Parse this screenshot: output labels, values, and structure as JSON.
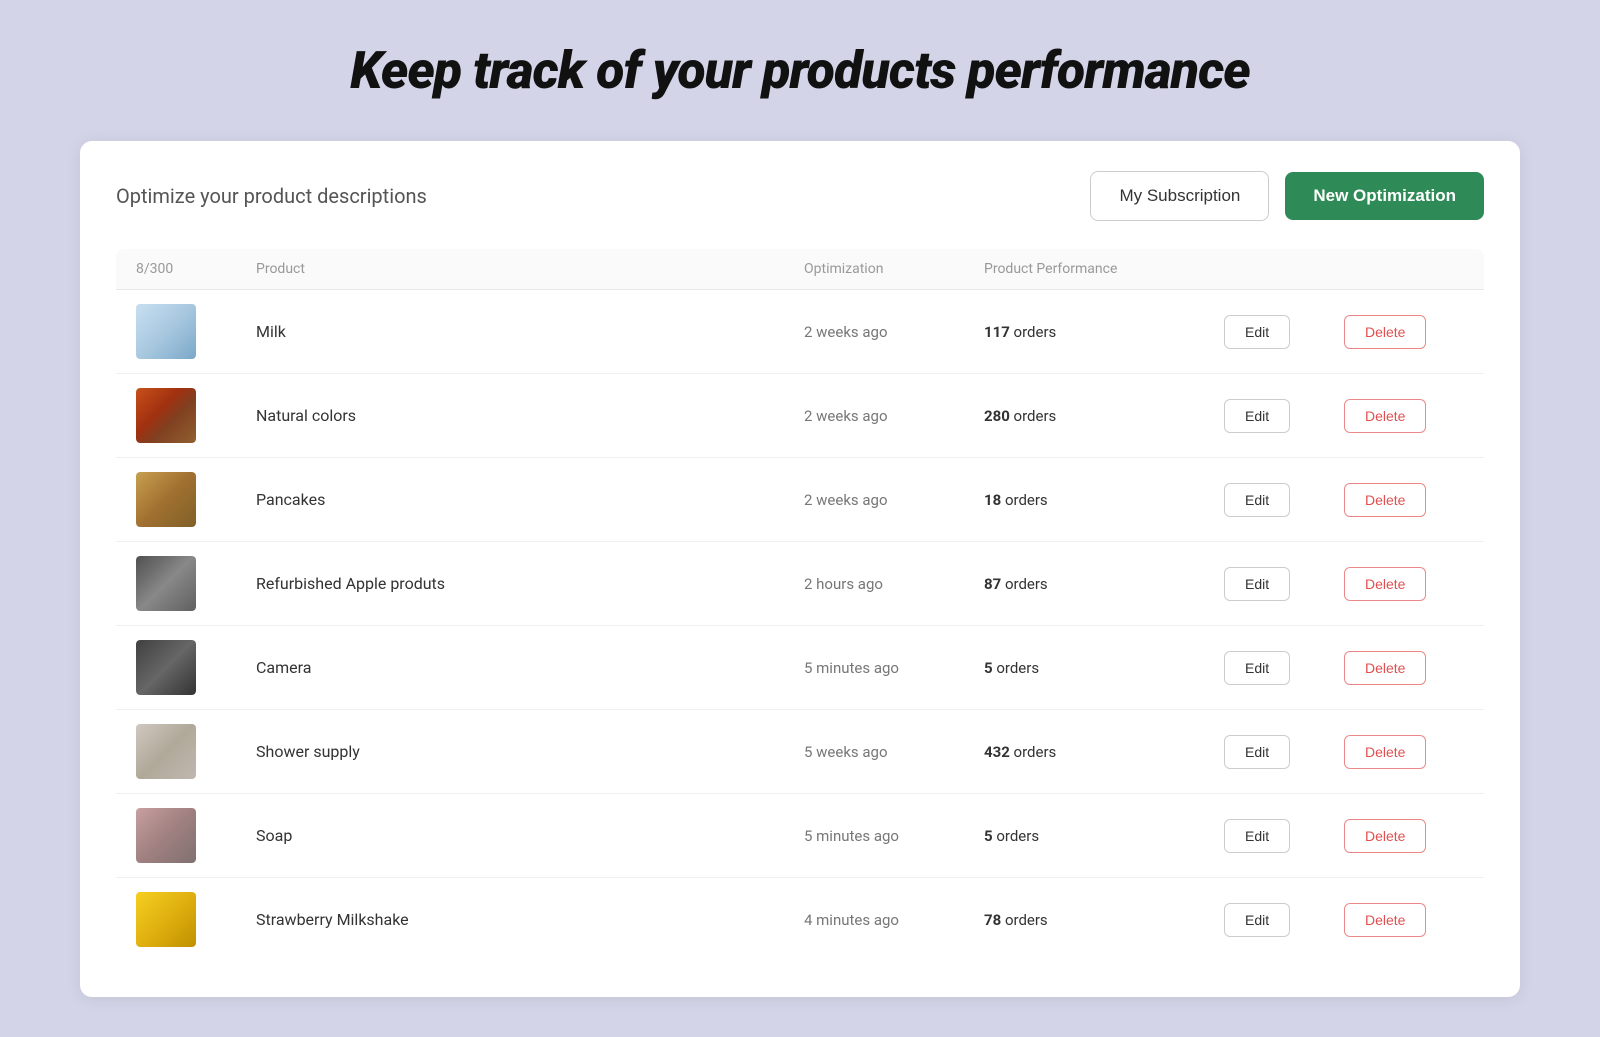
{
  "page": {
    "background_color": "#d4d4e8",
    "hero_title": "Keep track of your products performance",
    "card": {
      "subtitle": "Optimize your product descriptions",
      "buttons": {
        "subscription_label": "My Subscription",
        "new_opt_label": "New Optimization"
      },
      "table": {
        "counter": "8/300",
        "columns": [
          "8/300",
          "Product",
          "Optimization",
          "Product Performance",
          "",
          ""
        ],
        "rows": [
          {
            "id": "milk",
            "img_class": "img-milk",
            "product": "Milk",
            "optimization": "2 weeks ago",
            "performance_count": "117",
            "performance_unit": "orders"
          },
          {
            "id": "natural-colors",
            "img_class": "img-natural",
            "product": "Natural colors",
            "optimization": "2 weeks ago",
            "performance_count": "280",
            "performance_unit": "orders"
          },
          {
            "id": "pancakes",
            "img_class": "img-pancakes",
            "product": "Pancakes",
            "optimization": "2 weeks ago",
            "performance_count": "18",
            "performance_unit": "orders"
          },
          {
            "id": "refurbished-apple",
            "img_class": "img-apple",
            "product": "Refurbished Apple produts",
            "optimization": "2 hours ago",
            "performance_count": "87",
            "performance_unit": "orders"
          },
          {
            "id": "camera",
            "img_class": "img-camera",
            "product": "Camera",
            "optimization": "5 minutes ago",
            "performance_count": "5",
            "performance_unit": "orders"
          },
          {
            "id": "shower-supply",
            "img_class": "img-shower",
            "product": "Shower supply",
            "optimization": "5 weeks ago",
            "performance_count": "432",
            "performance_unit": "orders"
          },
          {
            "id": "soap",
            "img_class": "img-soap",
            "product": "Soap",
            "optimization": "5 minutes ago",
            "performance_count": "5",
            "performance_unit": "orders"
          },
          {
            "id": "strawberry-milkshake",
            "img_class": "img-strawberry",
            "product": "Strawberry Milkshake",
            "optimization": "4 minutes ago",
            "performance_count": "78",
            "performance_unit": "orders"
          }
        ],
        "edit_label": "Edit",
        "delete_label": "Delete"
      }
    }
  }
}
